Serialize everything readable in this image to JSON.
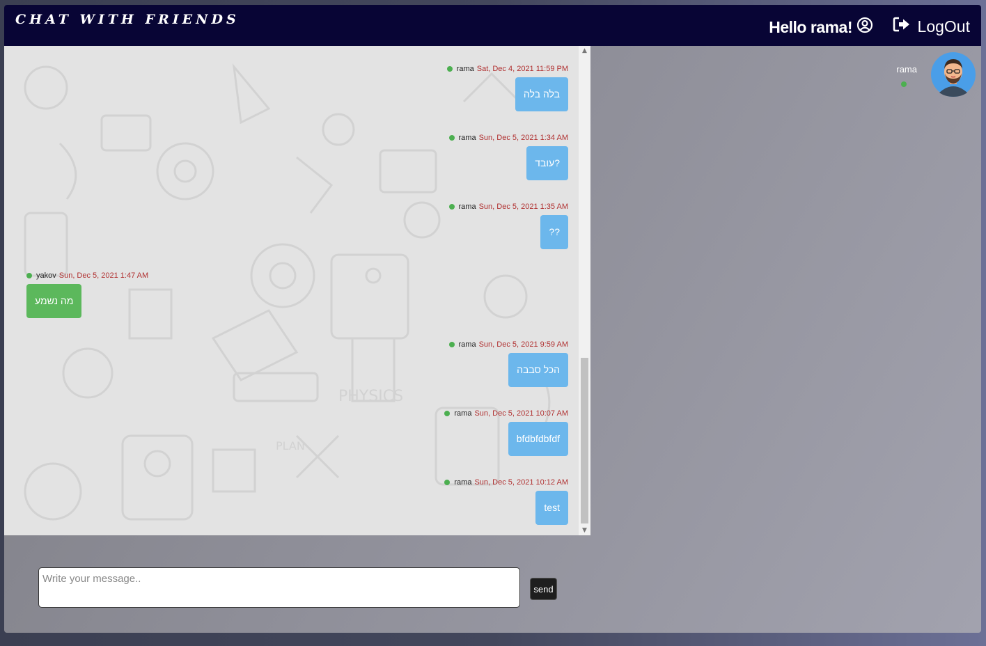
{
  "header": {
    "brand": "CHAT WITH FRIENDS",
    "hello_text": "Hello rama!",
    "logout_label": "LogOut"
  },
  "messages": [
    {
      "user": "rama",
      "time": "Sat, Dec 4, 2021 11:59 PM",
      "text": "בלה בלה",
      "side": "right"
    },
    {
      "user": "rama",
      "time": "Sun, Dec 5, 2021 1:34 AM",
      "text": "עובד?",
      "side": "right"
    },
    {
      "user": "rama",
      "time": "Sun, Dec 5, 2021 1:35 AM",
      "text": "??",
      "side": "right"
    },
    {
      "user": "yakov",
      "time": "Sun, Dec 5, 2021 1:47 AM",
      "text": "מה נשמע",
      "side": "left"
    },
    {
      "user": "rama",
      "time": "Sun, Dec 5, 2021 9:59 AM",
      "text": "הכל סבבה",
      "side": "right"
    },
    {
      "user": "rama",
      "time": "Sun, Dec 5, 2021 10:07 AM",
      "text": "bfdbfdbfdf",
      "side": "right"
    },
    {
      "user": "rama",
      "time": "Sun, Dec 5, 2021 10:12 AM",
      "text": "test",
      "side": "right"
    }
  ],
  "composer": {
    "placeholder": "Write your message..",
    "value": "",
    "send_label": "send"
  },
  "online_users": [
    {
      "name": "rama",
      "status": "online"
    }
  ],
  "colors": {
    "navbar": "#080535",
    "own_bubble": "#6cb7ec",
    "other_bubble": "#5cb85c",
    "online_dot": "#4caf50",
    "timestamp": "#b03030"
  }
}
